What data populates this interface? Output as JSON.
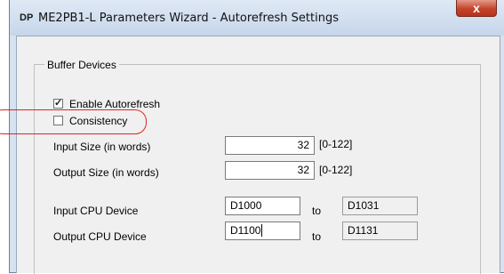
{
  "window": {
    "app_icon": "DP",
    "title": "ME2PB1-L Parameters Wizard - Autorefresh Settings",
    "close_glyph": "x"
  },
  "group": {
    "legend": "Buffer Devices",
    "enable_autorefresh": {
      "label": "Enable Autorefresh",
      "checked": true
    },
    "consistency": {
      "label": "Consistency",
      "checked": false
    }
  },
  "input_size": {
    "label": "Input Size (in words)",
    "value": "32",
    "range": "[0-122]"
  },
  "output_size": {
    "label": "Output Size (in words)",
    "value": "32",
    "range": "[0-122]"
  },
  "input_cpu": {
    "label": "Input CPU Device",
    "from": "D1000",
    "to_label": "to",
    "to": "D1031"
  },
  "output_cpu": {
    "label": "Output CPU Device",
    "from": "D1100",
    "to_label": "to",
    "to": "D1131"
  },
  "annotation": {
    "color": "#e0241c"
  }
}
